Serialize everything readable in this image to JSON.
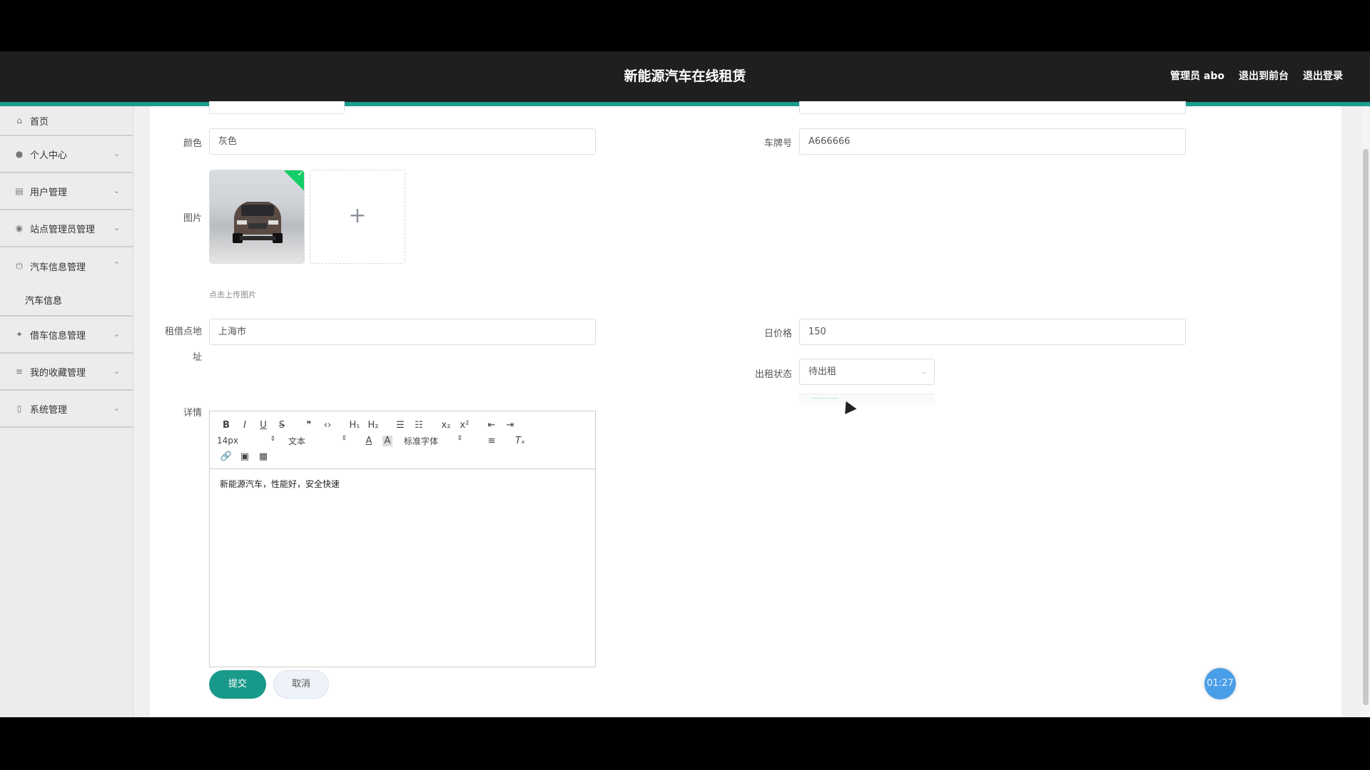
{
  "header": {
    "title": "新能源汽车在线租赁",
    "user": "管理员 abo",
    "to_front": "退出到前台",
    "logout": "退出登录"
  },
  "sidebar": {
    "items": [
      {
        "label": "首页",
        "icon": "home-icon"
      },
      {
        "label": "个人中心",
        "icon": "user-icon"
      },
      {
        "label": "用户管理",
        "icon": "clipboard-icon"
      },
      {
        "label": "站点管理员管理",
        "icon": "location-icon"
      },
      {
        "label": "汽车信息管理",
        "icon": "power-icon"
      },
      {
        "label": "借车信息管理",
        "icon": "compass-icon"
      },
      {
        "label": "我的收藏管理",
        "icon": "stack-icon"
      },
      {
        "label": "系统管理",
        "icon": "phone-icon"
      }
    ],
    "sub_item": "汽车信息"
  },
  "form": {
    "color_label": "颜色",
    "color_value": "灰色",
    "plate_label": "车牌号",
    "plate_value": "A666666",
    "image_label": "图片",
    "upload_hint": "点击上传图片",
    "location_label_1": "租借点地",
    "location_label_2": "址",
    "location_value": "上海市",
    "price_label": "日价格",
    "price_value": "150",
    "status_label": "出租状态",
    "status_value": "待出租",
    "detail_label": "详情"
  },
  "editor": {
    "font_size": "14px",
    "block_type": "文本",
    "font_family": "标准字体",
    "content": "新能源汽车，性能好，安全快速"
  },
  "buttons": {
    "submit": "提交",
    "cancel": "取消"
  },
  "timer": "01:27",
  "colors": {
    "accent": "#1a9c8e",
    "topbar": "#1f1f1f",
    "submit": "#18998a",
    "timer": "#4a9ee8"
  }
}
